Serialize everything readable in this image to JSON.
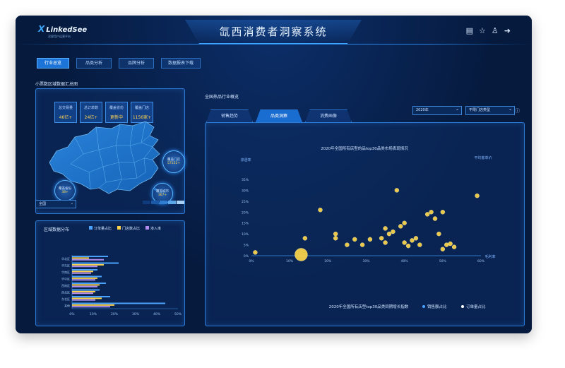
{
  "header": {
    "logo": "LinkedSee",
    "logo_sub": "灵犀用户运营平台",
    "title": "氙西消费者洞察系统",
    "icons": [
      "monitor-icon",
      "star-icon",
      "user-icon",
      "logout-icon"
    ]
  },
  "nav": [
    {
      "label": "行业总览",
      "active": true
    },
    {
      "label": "品类分析",
      "active": false
    },
    {
      "label": "品牌分析",
      "active": false
    },
    {
      "label": "数据报表下载",
      "active": false
    }
  ],
  "left": {
    "map_title": "小票数区域数据汇总图",
    "stats": [
      {
        "label": "总交易量",
        "value": "46亿+"
      },
      {
        "label": "总订单数",
        "value": "24亿+"
      },
      {
        "label": "覆盖省份",
        "value": "更新中"
      },
      {
        "label": "覆盖门店",
        "value": "1156家+"
      }
    ],
    "bubbles": [
      {
        "label": "覆盖门店",
        "value": "57152+"
      },
      {
        "label": "覆盖省份",
        "value": "38+"
      },
      {
        "label": "覆盖城市",
        "value": "367+"
      }
    ],
    "region_select": "全国",
    "legend_colors": [
      "#0f3b7c",
      "#1a5aa8",
      "#2f7ed0",
      "#5ca7ea",
      "#a8d2f5"
    ],
    "bar_title": "区域数据分布",
    "bar_legend": [
      {
        "name": "订单量占比",
        "color": "#4aa4ff"
      },
      {
        "name": "门店数占比",
        "color": "#ffd34e"
      },
      {
        "name": "渗入率",
        "color": "#b38ef0"
      }
    ]
  },
  "right": {
    "title": "全国热品行业概览",
    "tabs": [
      {
        "label": "销售趋势",
        "active": false
      },
      {
        "label": "品类洞察",
        "active": true
      },
      {
        "label": "消费画像",
        "active": false
      }
    ],
    "year_select": "2020年",
    "type_select": "不限门店类型",
    "scatter_title": "2020年全国所有店型的品top30品类市场表现情况",
    "scatter_footer": "2020年全国所有店型top30品类同期增长指数",
    "scatter_legend": [
      {
        "name": "销售额占比",
        "color": "#4aa4ff"
      },
      {
        "name": "订单量占比",
        "color": "#ffffff"
      }
    ]
  },
  "chart_data": [
    {
      "type": "scatter",
      "title": "2020年全国所有店型的品top30品类市场表现情况",
      "xlabel": "毛利率",
      "ylabel": "渗透率",
      "y2label": "平均客单价",
      "xlim": [
        0,
        60
      ],
      "ylim": [
        0,
        35
      ],
      "xticks": [
        "0%",
        "10%",
        "20%",
        "30%",
        "40%",
        "50%",
        "60%"
      ],
      "yticks": [
        "0%",
        "5%",
        "10%",
        "15%",
        "20%",
        "25%",
        "30%",
        "35%"
      ],
      "points": [
        {
          "x": 1,
          "y": 1.5,
          "r": 1
        },
        {
          "x": 13,
          "y": 0.5,
          "r": 4
        },
        {
          "x": 14,
          "y": 8,
          "r": 1
        },
        {
          "x": 18,
          "y": 21,
          "r": 1
        },
        {
          "x": 22,
          "y": 10,
          "r": 1
        },
        {
          "x": 22,
          "y": 8,
          "r": 1
        },
        {
          "x": 25,
          "y": 5,
          "r": 1
        },
        {
          "x": 27,
          "y": 7.5,
          "r": 1
        },
        {
          "x": 29,
          "y": 5,
          "r": 1
        },
        {
          "x": 31,
          "y": 7.5,
          "r": 1
        },
        {
          "x": 34,
          "y": 8,
          "r": 1
        },
        {
          "x": 35,
          "y": 6,
          "r": 1
        },
        {
          "x": 35,
          "y": 12.5,
          "r": 1
        },
        {
          "x": 36,
          "y": 10,
          "r": 1
        },
        {
          "x": 37,
          "y": 11,
          "r": 1
        },
        {
          "x": 38,
          "y": 30,
          "r": 1
        },
        {
          "x": 39,
          "y": 13.5,
          "r": 1
        },
        {
          "x": 40,
          "y": 15,
          "r": 1
        },
        {
          "x": 40,
          "y": 6,
          "r": 1
        },
        {
          "x": 41,
          "y": 4.5,
          "r": 1
        },
        {
          "x": 42,
          "y": 7,
          "r": 1
        },
        {
          "x": 43,
          "y": 8,
          "r": 1
        },
        {
          "x": 44,
          "y": 5,
          "r": 1
        },
        {
          "x": 46,
          "y": 19,
          "r": 1
        },
        {
          "x": 47,
          "y": 20,
          "r": 1
        },
        {
          "x": 48,
          "y": 17,
          "r": 1
        },
        {
          "x": 49,
          "y": 10,
          "r": 1
        },
        {
          "x": 50,
          "y": 20,
          "r": 1
        },
        {
          "x": 50,
          "y": 3,
          "r": 1
        },
        {
          "x": 51,
          "y": 5,
          "r": 1
        },
        {
          "x": 52,
          "y": 5.5,
          "r": 1
        },
        {
          "x": 53,
          "y": 4,
          "r": 1
        },
        {
          "x": 59,
          "y": 27.5,
          "r": 1
        }
      ]
    },
    {
      "type": "bar",
      "orientation": "horizontal",
      "title": "区域数据分布",
      "categories": [
        "华北区",
        "华东区",
        "华南区",
        "华中区",
        "西南区",
        "西北区",
        "东北区",
        "其他"
      ],
      "xticks": [
        "0%",
        "10%",
        "20%",
        "30%",
        "40%",
        "50%"
      ],
      "xlim": [
        0,
        50
      ],
      "series": [
        {
          "name": "订单量占比",
          "color": "#4aa4ff",
          "values": [
            17,
            22,
            12,
            14,
            16,
            13,
            18,
            44
          ]
        },
        {
          "name": "门店数占比",
          "color": "#ffd34e",
          "values": [
            8,
            15,
            10,
            12,
            13,
            11,
            14,
            20
          ]
        },
        {
          "name": "渗入率",
          "color": "#b38ef0",
          "values": [
            15,
            12,
            9,
            11,
            12,
            10,
            11,
            18
          ]
        }
      ]
    }
  ]
}
